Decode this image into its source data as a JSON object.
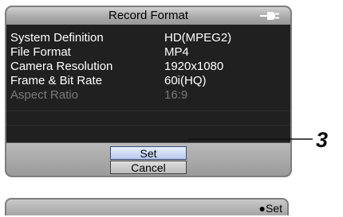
{
  "header": {
    "title": "Record Format",
    "icon": "power-plug-icon"
  },
  "settings": [
    {
      "label": "System Definition",
      "value": "HD(MPEG2)"
    },
    {
      "label": "File Format",
      "value": "MP4"
    },
    {
      "label": "Camera Resolution",
      "value": "1920x1080"
    },
    {
      "label": "Frame & Bit Rate",
      "value": "60i(HQ)"
    },
    {
      "label": "Aspect Ratio",
      "value": "16:9"
    }
  ],
  "buttons": {
    "set": "Set",
    "cancel": "Cancel"
  },
  "footer": {
    "hint": "●Set"
  },
  "callout": {
    "number": "3"
  },
  "colors": {
    "selection": "#b8c9ee",
    "disabled_text": "#7a7a7a"
  }
}
